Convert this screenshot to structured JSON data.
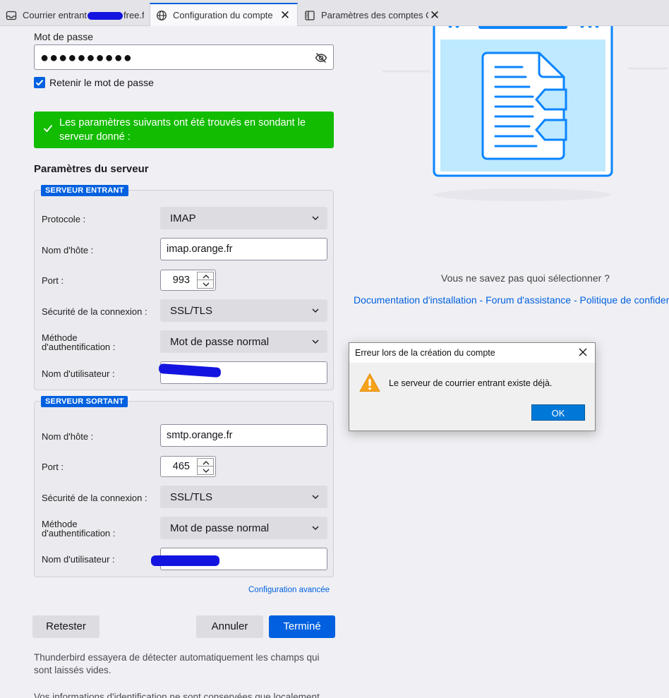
{
  "tabs": [
    {
      "label_prefix": "Courrier entrant",
      "label_suffix": "free.fr"
    },
    {
      "label": "Configuration du compte"
    },
    {
      "label": "Paramètres des comptes Co"
    }
  ],
  "form": {
    "password_label": "Mot de passe",
    "password_value": "●●●●●●●●●●",
    "remember_label": "Retenir le mot de passe",
    "remember_checked": true,
    "success_message": "Les paramètres suivants ont été trouvés en sondant le serveur donné :",
    "section_title": "Paramètres du serveur"
  },
  "incoming": {
    "legend": "SERVEUR ENTRANT",
    "protocol_label": "Protocole :",
    "protocol_value": "IMAP",
    "hostname_label": "Nom d'hôte :",
    "hostname_value": "imap.orange.fr",
    "port_label": "Port :",
    "port_value": "993",
    "security_label": "Sécurité de la connexion :",
    "security_value": "SSL/TLS",
    "auth_label_line1": "Méthode",
    "auth_label_line2": "d'authentification :",
    "auth_value": "Mot de passe normal",
    "username_label": "Nom d'utilisateur :"
  },
  "outgoing": {
    "legend": "SERVEUR SORTANT",
    "hostname_label": "Nom d'hôte :",
    "hostname_value": "smtp.orange.fr",
    "port_label": "Port :",
    "port_value": "465",
    "security_label": "Sécurité de la connexion :",
    "security_value": "SSL/TLS",
    "auth_label_line1": "Méthode",
    "auth_label_line2": "d'authentification :",
    "auth_value": "Mot de passe normal",
    "username_label": "Nom d'utilisateur :"
  },
  "advanced_link": "Configuration avancée",
  "buttons": {
    "retest": "Retester",
    "cancel": "Annuler",
    "done": "Terminé"
  },
  "notes": {
    "auto_detect": "Thunderbird essayera de détecter automatiquement les champs qui sont laissés vides.",
    "local_storage": "Vos informations d'identification ne sont conservées que localement, sur"
  },
  "help": {
    "question": "Vous ne savez pas quoi sélectionner ?",
    "links": "Documentation d'installation - Forum d'assistance - Politique de confiden"
  },
  "dialog": {
    "title": "Erreur lors de la création du compte",
    "message": "Le serveur de courrier entrant existe déjà.",
    "ok": "OK"
  },
  "colors": {
    "accent": "#0060df",
    "success": "#12bc00",
    "warning": "#f7a21c"
  }
}
